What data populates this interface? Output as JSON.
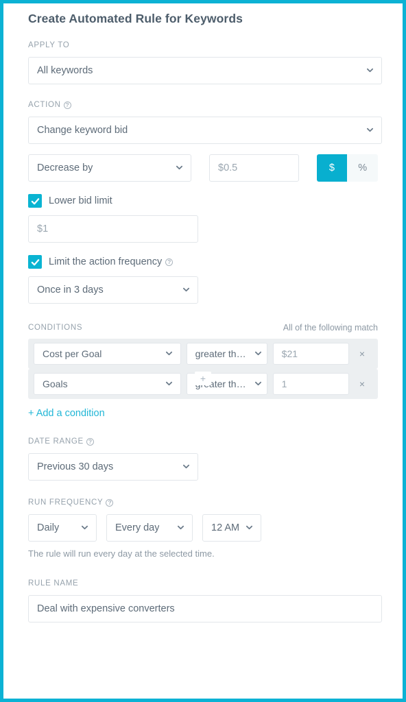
{
  "dialog": {
    "title": "Create Automated Rule for Keywords",
    "accent_color": "#0cb2d4",
    "help_glyph": "?",
    "remove_glyph": "×",
    "plus_glyph": "+"
  },
  "apply_to": {
    "label": "APPLY TO",
    "value": "All keywords"
  },
  "action": {
    "label": "ACTION",
    "value": "Change keyword bid",
    "operation": "Decrease by",
    "amount": "$0.5",
    "unit_currency": "$",
    "unit_percent": "%",
    "unit_selected": "$"
  },
  "lower_bid_limit": {
    "label": "Lower bid limit",
    "checked": true,
    "value": "$1"
  },
  "limit_frequency": {
    "label": "Limit the action frequency",
    "checked": true,
    "value": "Once in 3 days"
  },
  "conditions": {
    "label": "CONDITIONS",
    "match_note": "All of the following match",
    "add_label": "+ Add a condition",
    "rows": [
      {
        "metric": "Cost per Goal",
        "operator": "greater than",
        "value": "$21"
      },
      {
        "metric": "Goals",
        "operator": "greater than",
        "value": "1"
      }
    ]
  },
  "date_range": {
    "label": "DATE RANGE",
    "value": "Previous 30 days"
  },
  "run_frequency": {
    "label": "RUN FREQUENCY",
    "interval": "Daily",
    "day": "Every day",
    "time": "12 AM",
    "note": "The rule will run every day at the selected time."
  },
  "rule_name": {
    "label": "RULE NAME",
    "value": "Deal with expensive converters"
  }
}
